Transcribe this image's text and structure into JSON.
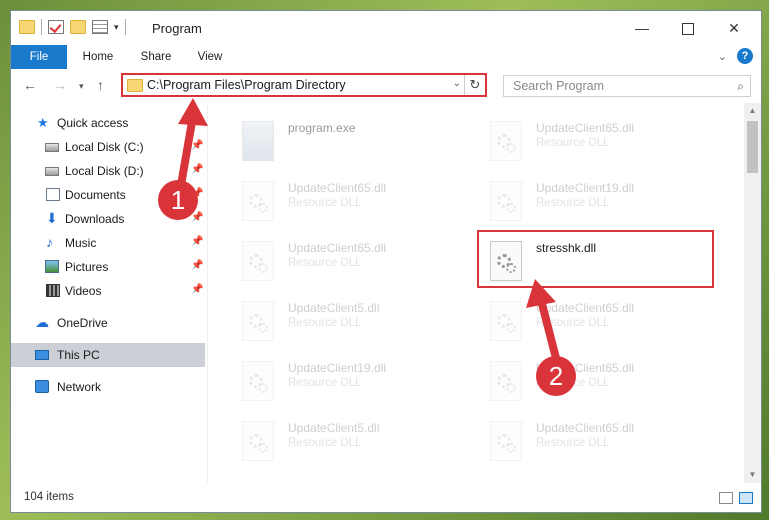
{
  "titlebar": {
    "title": "Program",
    "minimize": "—",
    "close": "✕",
    "qat_dropdown": "▾"
  },
  "ribbon": {
    "tabs": [
      {
        "label": "File"
      },
      {
        "label": "Home"
      },
      {
        "label": "Share"
      },
      {
        "label": "View"
      }
    ],
    "expand_chevron": "⌄",
    "help_label": "?"
  },
  "navigation": {
    "back": "←",
    "forward": "→",
    "recent": "▾",
    "up": "↑",
    "address": "C:\\Program Files\\Program Directory",
    "address_dropdown": "⌄",
    "refresh": "↻",
    "search_placeholder": "Search Program",
    "search_icon": "⌕"
  },
  "sidebar": {
    "items": [
      {
        "label": "Quick access",
        "icon": "star-icon"
      },
      {
        "label": "Local Disk (C:)",
        "icon": "disk-icon",
        "pinned": true
      },
      {
        "label": "Local Disk (D:)",
        "icon": "disk-icon",
        "pinned": true
      },
      {
        "label": "Documents",
        "icon": "documents-icon",
        "pinned": true
      },
      {
        "label": "Downloads",
        "icon": "download-icon",
        "pinned": true
      },
      {
        "label": "Music",
        "icon": "music-icon",
        "pinned": true
      },
      {
        "label": "Pictures",
        "icon": "pictures-icon",
        "pinned": true
      },
      {
        "label": "Videos",
        "icon": "videos-icon",
        "pinned": true
      },
      {
        "label": "OneDrive",
        "icon": "cloud-icon"
      },
      {
        "label": "This PC",
        "icon": "computer-icon",
        "selected": true
      },
      {
        "label": "Network",
        "icon": "network-icon"
      }
    ],
    "pin_glyph": "📌"
  },
  "files": [
    {
      "name": "program.exe",
      "type": ""
    },
    {
      "name": "UpdateClient65.dll",
      "type": "Resource DLL"
    },
    {
      "name": "UpdateClient65.dll",
      "type": "Resource DLL"
    },
    {
      "name": "UpdateClient19.dll",
      "type": "Resource DLL"
    },
    {
      "name": "UpdateClient65.dll",
      "type": "Resource DLL"
    },
    {
      "name": "stresshk.dll",
      "type": ""
    },
    {
      "name": "UpdateClient5.dll",
      "type": "Resource DLL"
    },
    {
      "name": "UpdateClient65.dll",
      "type": "Resource DLL"
    },
    {
      "name": "UpdateClient19.dll",
      "type": "Resource DLL"
    },
    {
      "name": "UpdateClient65.dll",
      "type": "Resource DLL"
    },
    {
      "name": "UpdateClient5.dll",
      "type": "Resource DLL"
    },
    {
      "name": "UpdateClient65.dll",
      "type": "Resource DLL"
    }
  ],
  "status": {
    "items_count": "104 items"
  },
  "annotations": {
    "callout_1": "1",
    "callout_2": "2"
  },
  "colors": {
    "accent": "#1979ca",
    "highlight": "#d9343a"
  }
}
